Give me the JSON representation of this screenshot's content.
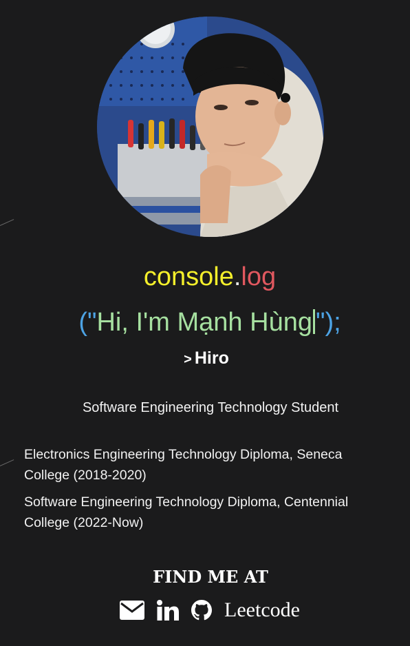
{
  "profile": {
    "photo_alt": "Profile photo",
    "console_object": "console",
    "console_dot": ".",
    "console_method": "log",
    "open_paren": "(\"",
    "greeting": "Hi, I'm Mạnh Hùng",
    "close_paren": "\");",
    "nickname_arrow": ">",
    "nickname": "Hiro",
    "role": "Software Engineering Technology Student"
  },
  "education": [
    "Electronics Engineering Technology Diploma, Seneca College (2018-2020)",
    "Software Engineering Technology Diploma, Centennial College (2022-Now)"
  ],
  "contact": {
    "title": "FIND ME AT",
    "email_icon": "envelope-icon",
    "linkedin_icon": "linkedin-icon",
    "github_icon": "github-icon",
    "leetcode_label": "Leetcode"
  },
  "colors": {
    "background": "#1b1b1c",
    "console_object": "#f4ef2b",
    "console_method": "#e0585f",
    "punctuation": "#4da3e4",
    "greeting": "#a6e0a0"
  }
}
